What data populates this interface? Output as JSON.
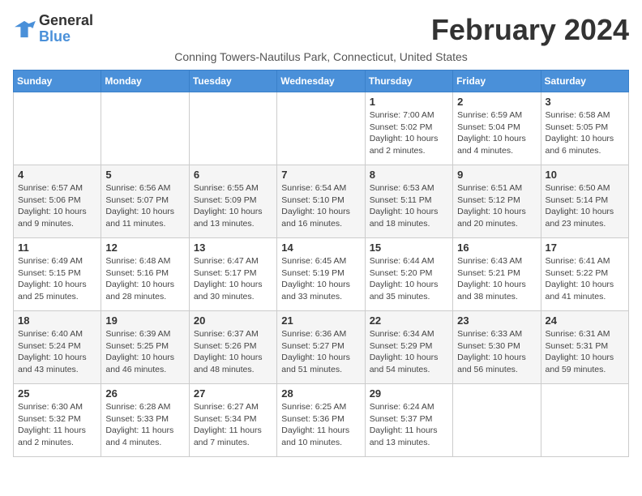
{
  "logo": {
    "line1": "General",
    "line2": "Blue"
  },
  "title": "February 2024",
  "subtitle": "Conning Towers-Nautilus Park, Connecticut, United States",
  "days_of_week": [
    "Sunday",
    "Monday",
    "Tuesday",
    "Wednesday",
    "Thursday",
    "Friday",
    "Saturday"
  ],
  "weeks": [
    [
      {
        "day": "",
        "info": ""
      },
      {
        "day": "",
        "info": ""
      },
      {
        "day": "",
        "info": ""
      },
      {
        "day": "",
        "info": ""
      },
      {
        "day": "1",
        "info": "Sunrise: 7:00 AM\nSunset: 5:02 PM\nDaylight: 10 hours\nand 2 minutes."
      },
      {
        "day": "2",
        "info": "Sunrise: 6:59 AM\nSunset: 5:04 PM\nDaylight: 10 hours\nand 4 minutes."
      },
      {
        "day": "3",
        "info": "Sunrise: 6:58 AM\nSunset: 5:05 PM\nDaylight: 10 hours\nand 6 minutes."
      }
    ],
    [
      {
        "day": "4",
        "info": "Sunrise: 6:57 AM\nSunset: 5:06 PM\nDaylight: 10 hours\nand 9 minutes."
      },
      {
        "day": "5",
        "info": "Sunrise: 6:56 AM\nSunset: 5:07 PM\nDaylight: 10 hours\nand 11 minutes."
      },
      {
        "day": "6",
        "info": "Sunrise: 6:55 AM\nSunset: 5:09 PM\nDaylight: 10 hours\nand 13 minutes."
      },
      {
        "day": "7",
        "info": "Sunrise: 6:54 AM\nSunset: 5:10 PM\nDaylight: 10 hours\nand 16 minutes."
      },
      {
        "day": "8",
        "info": "Sunrise: 6:53 AM\nSunset: 5:11 PM\nDaylight: 10 hours\nand 18 minutes."
      },
      {
        "day": "9",
        "info": "Sunrise: 6:51 AM\nSunset: 5:12 PM\nDaylight: 10 hours\nand 20 minutes."
      },
      {
        "day": "10",
        "info": "Sunrise: 6:50 AM\nSunset: 5:14 PM\nDaylight: 10 hours\nand 23 minutes."
      }
    ],
    [
      {
        "day": "11",
        "info": "Sunrise: 6:49 AM\nSunset: 5:15 PM\nDaylight: 10 hours\nand 25 minutes."
      },
      {
        "day": "12",
        "info": "Sunrise: 6:48 AM\nSunset: 5:16 PM\nDaylight: 10 hours\nand 28 minutes."
      },
      {
        "day": "13",
        "info": "Sunrise: 6:47 AM\nSunset: 5:17 PM\nDaylight: 10 hours\nand 30 minutes."
      },
      {
        "day": "14",
        "info": "Sunrise: 6:45 AM\nSunset: 5:19 PM\nDaylight: 10 hours\nand 33 minutes."
      },
      {
        "day": "15",
        "info": "Sunrise: 6:44 AM\nSunset: 5:20 PM\nDaylight: 10 hours\nand 35 minutes."
      },
      {
        "day": "16",
        "info": "Sunrise: 6:43 AM\nSunset: 5:21 PM\nDaylight: 10 hours\nand 38 minutes."
      },
      {
        "day": "17",
        "info": "Sunrise: 6:41 AM\nSunset: 5:22 PM\nDaylight: 10 hours\nand 41 minutes."
      }
    ],
    [
      {
        "day": "18",
        "info": "Sunrise: 6:40 AM\nSunset: 5:24 PM\nDaylight: 10 hours\nand 43 minutes."
      },
      {
        "day": "19",
        "info": "Sunrise: 6:39 AM\nSunset: 5:25 PM\nDaylight: 10 hours\nand 46 minutes."
      },
      {
        "day": "20",
        "info": "Sunrise: 6:37 AM\nSunset: 5:26 PM\nDaylight: 10 hours\nand 48 minutes."
      },
      {
        "day": "21",
        "info": "Sunrise: 6:36 AM\nSunset: 5:27 PM\nDaylight: 10 hours\nand 51 minutes."
      },
      {
        "day": "22",
        "info": "Sunrise: 6:34 AM\nSunset: 5:29 PM\nDaylight: 10 hours\nand 54 minutes."
      },
      {
        "day": "23",
        "info": "Sunrise: 6:33 AM\nSunset: 5:30 PM\nDaylight: 10 hours\nand 56 minutes."
      },
      {
        "day": "24",
        "info": "Sunrise: 6:31 AM\nSunset: 5:31 PM\nDaylight: 10 hours\nand 59 minutes."
      }
    ],
    [
      {
        "day": "25",
        "info": "Sunrise: 6:30 AM\nSunset: 5:32 PM\nDaylight: 11 hours\nand 2 minutes."
      },
      {
        "day": "26",
        "info": "Sunrise: 6:28 AM\nSunset: 5:33 PM\nDaylight: 11 hours\nand 4 minutes."
      },
      {
        "day": "27",
        "info": "Sunrise: 6:27 AM\nSunset: 5:34 PM\nDaylight: 11 hours\nand 7 minutes."
      },
      {
        "day": "28",
        "info": "Sunrise: 6:25 AM\nSunset: 5:36 PM\nDaylight: 11 hours\nand 10 minutes."
      },
      {
        "day": "29",
        "info": "Sunrise: 6:24 AM\nSunset: 5:37 PM\nDaylight: 11 hours\nand 13 minutes."
      },
      {
        "day": "",
        "info": ""
      },
      {
        "day": "",
        "info": ""
      }
    ]
  ]
}
